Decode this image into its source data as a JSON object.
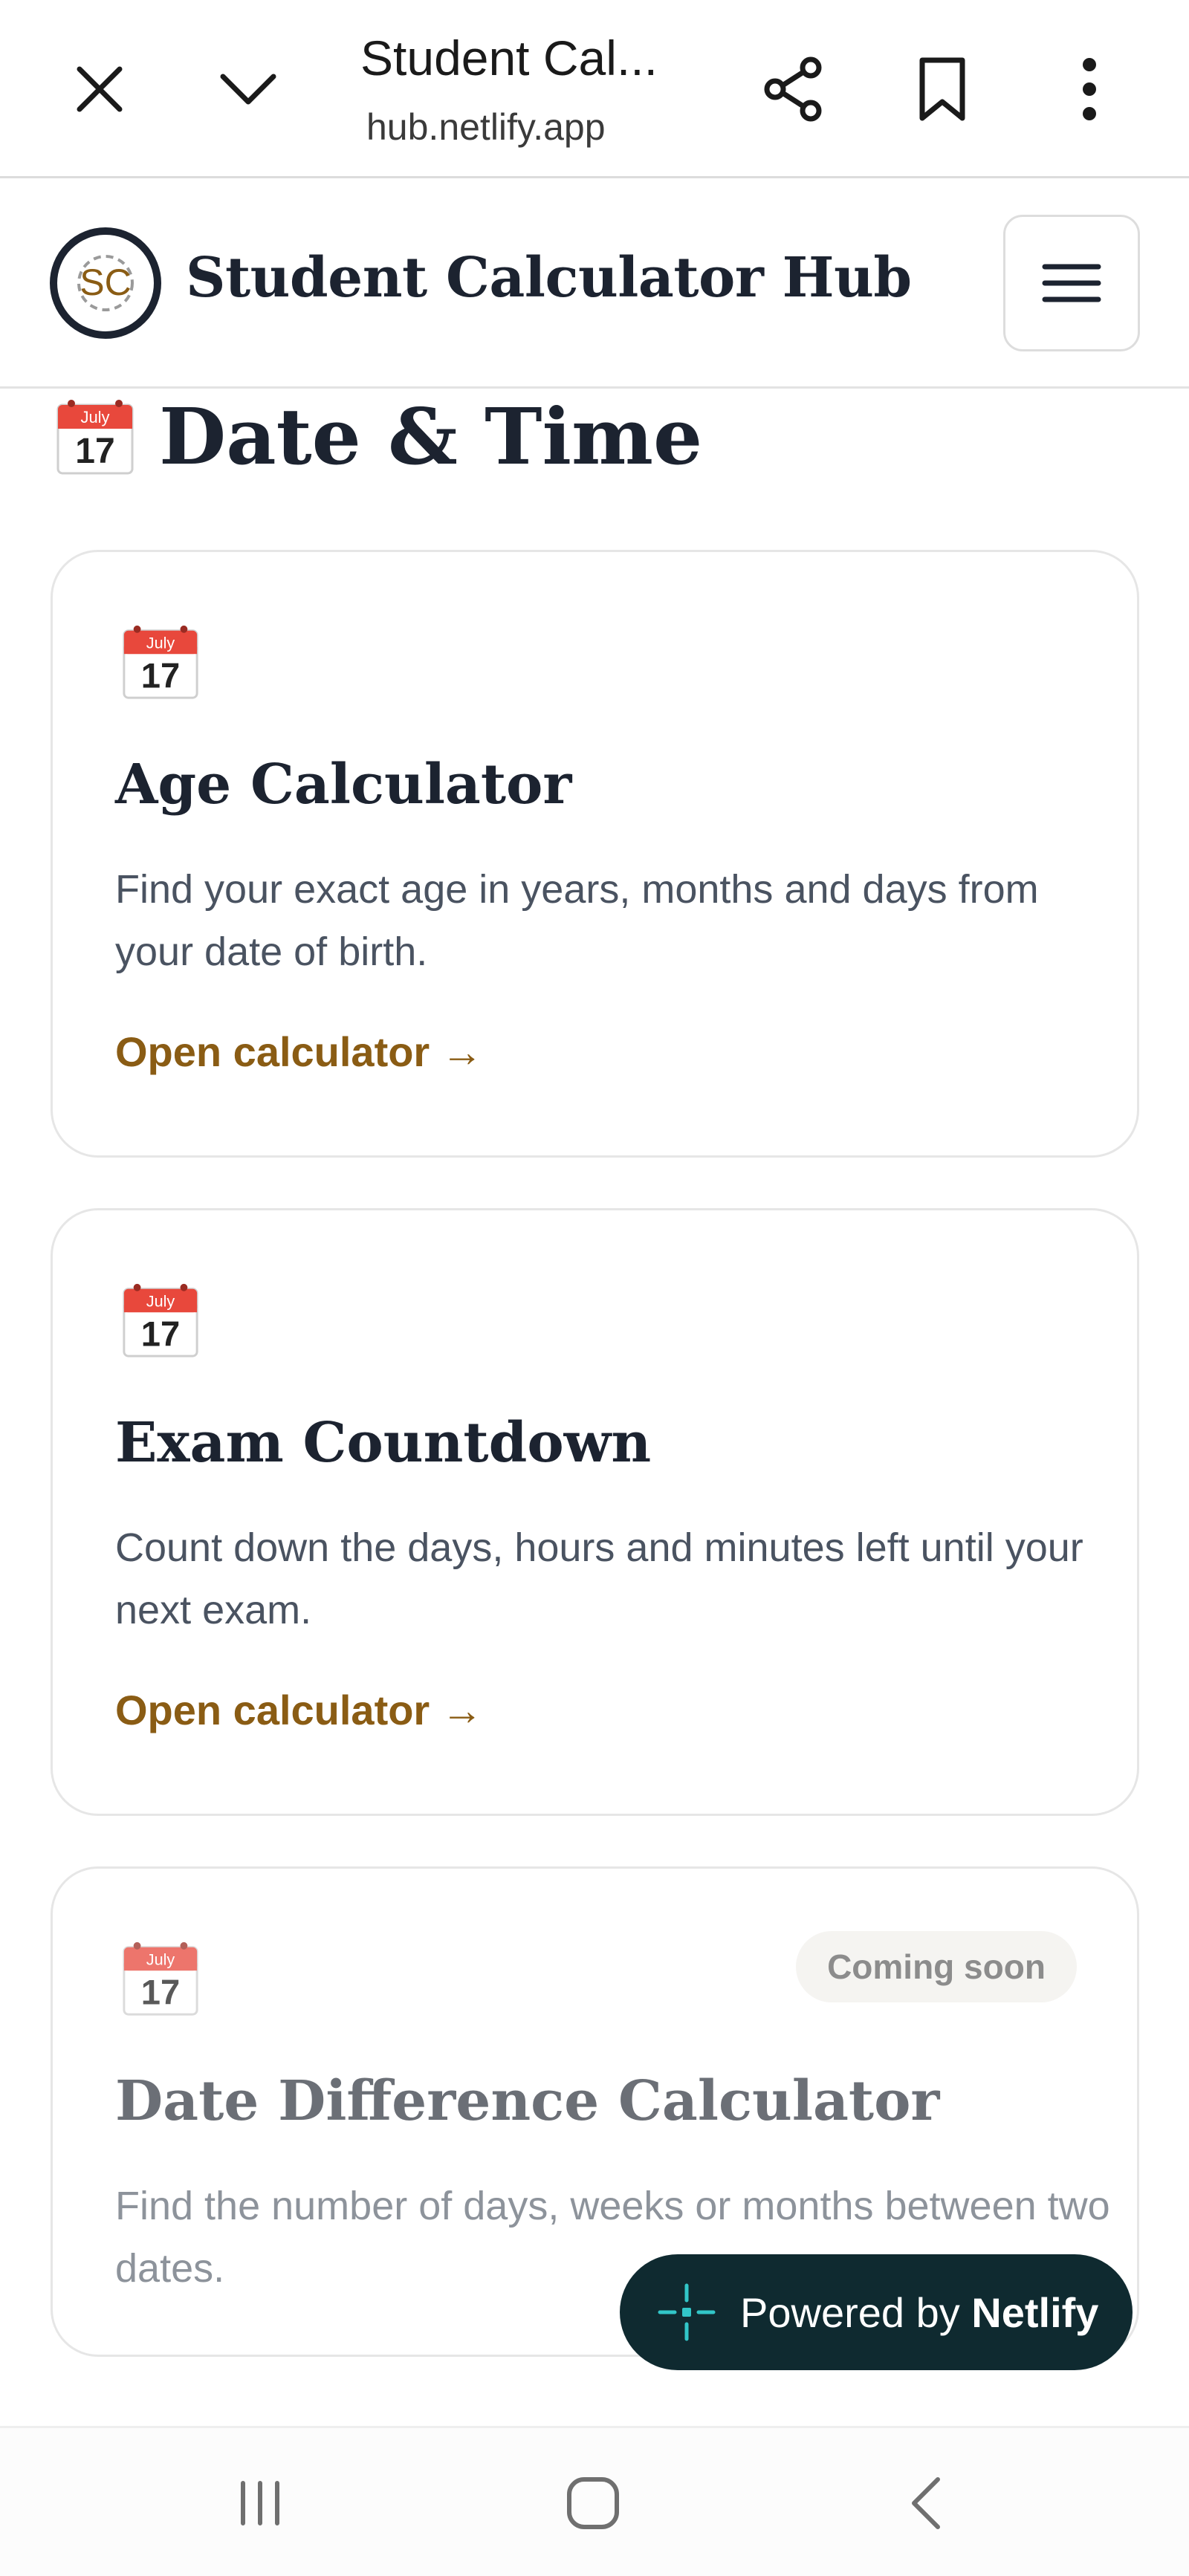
{
  "browser": {
    "title": "Student Cal...",
    "url": "hub.netlify.app",
    "icons": [
      "close-icon",
      "chevron-down-icon",
      "share-icon",
      "bookmark-icon",
      "more-vert-icon"
    ]
  },
  "header": {
    "logo_text": "SC",
    "site_title": "Student Calculator Hub",
    "menu_icon": "hamburger-menu-icon"
  },
  "section": {
    "emoji_month": "July",
    "emoji_day": "17",
    "title": "Date & Time"
  },
  "cards": [
    {
      "title": "Age Calculator",
      "description": "Find your exact age in years, months and days from your date of birth.",
      "link": "Open calculator →"
    },
    {
      "title": "Exam Countdown",
      "description": "Count down the days, hours and minutes left until your next exam.",
      "link": "Open calculator →"
    },
    {
      "title": "Date Difference Calculator",
      "description": "Find the number of days, weeks or months between two dates.",
      "badge": "Coming soon"
    }
  ],
  "netlify": {
    "prefix": "Powered by ",
    "brand": "Netlify"
  },
  "colors": {
    "accent_link": "#8a5c14",
    "title_text": "#1c2330",
    "netlify_bg": "#0f2a30",
    "netlify_icon": "#32c6c8",
    "calendar_red": "#e8483c"
  },
  "nav": {
    "icons": [
      "recent-apps-icon",
      "home-icon",
      "back-icon"
    ]
  }
}
